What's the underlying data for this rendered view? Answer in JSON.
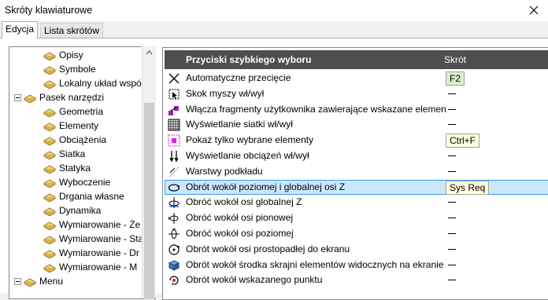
{
  "window": {
    "title": "Skróty klawiaturowe"
  },
  "tabs": [
    "Edycja",
    "Lista skrótów"
  ],
  "tree": {
    "items": [
      {
        "label": "Opisy",
        "level": 2,
        "expander": false
      },
      {
        "label": "Symbole",
        "level": 2,
        "expander": false
      },
      {
        "label": "Lokalny układ współ",
        "level": 2,
        "expander": false
      },
      {
        "label": "Pasek narzędzi",
        "level": 1,
        "expander": true
      },
      {
        "label": "Geometria",
        "level": 2,
        "expander": false
      },
      {
        "label": "Elementy",
        "level": 2,
        "expander": false
      },
      {
        "label": "Obciążenia",
        "level": 2,
        "expander": false
      },
      {
        "label": "Siatka",
        "level": 2,
        "expander": false
      },
      {
        "label": "Statyka",
        "level": 2,
        "expander": false
      },
      {
        "label": "Wyboczenie",
        "level": 2,
        "expander": false
      },
      {
        "label": "Drgania własne",
        "level": 2,
        "expander": false
      },
      {
        "label": "Dynamika",
        "level": 2,
        "expander": false
      },
      {
        "label": "Wymiarowanie - Że",
        "level": 2,
        "expander": false
      },
      {
        "label": "Wymiarowanie - Sta",
        "level": 2,
        "expander": false
      },
      {
        "label": "Wymiarowanie - Dr",
        "level": 2,
        "expander": false
      },
      {
        "label": "Wymiarowanie - M",
        "level": 2,
        "expander": false
      },
      {
        "label": "Menu",
        "level": 1,
        "expander": true
      }
    ]
  },
  "panel": {
    "header_name": "Przyciski szybkiego wyboru",
    "header_key": "Skrót",
    "rows": [
      {
        "label": "Automatyczne przecięcie",
        "key": "F2",
        "icon": "cross-icon"
      },
      {
        "label": "Skok myszy wł/wył",
        "key": "",
        "icon": "mouse-snap-icon"
      },
      {
        "label": "Włącza fragmenty użytkownika zawierające wskazane element",
        "key": "",
        "icon": "user-fragments-icon"
      },
      {
        "label": "Wyświetlanie siatki wł/wył",
        "key": "",
        "icon": "grid-icon"
      },
      {
        "label": "Pokaż tylko wybrane elementy",
        "key": "Ctrl+F",
        "icon": "show-selected-icon"
      },
      {
        "label": "Wyświetlanie obciążeń wł/wył",
        "key": "",
        "icon": "loads-icon"
      },
      {
        "label": "Warstwy podkładu",
        "key": "",
        "icon": "layers-icon"
      },
      {
        "label": "Obrót wokół poziomej i globalnej osi Z",
        "key": "Sys Req",
        "icon": "rotate-horizontal-z-icon"
      },
      {
        "label": "Obróć wokół osi globalnej Z",
        "key": "",
        "icon": "rotate-global-z-icon"
      },
      {
        "label": "Obróć wokół osi pionowej",
        "key": "",
        "icon": "rotate-vertical-icon"
      },
      {
        "label": "Obróć wokół osi poziomej",
        "key": "",
        "icon": "rotate-horizontal-icon"
      },
      {
        "label": "Obrót wokół osi prostopadłej do ekranu",
        "key": "",
        "icon": "rotate-screen-icon"
      },
      {
        "label": "Obrót wokół środka skrajni elementów widocznych na ekranie",
        "key": "",
        "icon": "rotate-center-icon"
      },
      {
        "label": "Obrót wokół wskazanego punktu",
        "key": "",
        "icon": "rotate-point-icon"
      }
    ]
  },
  "colors": {
    "header_bg": "#4e4e4e",
    "selection": "#cce8ff",
    "selection_border": "#3399ff"
  },
  "selected_row": 7
}
